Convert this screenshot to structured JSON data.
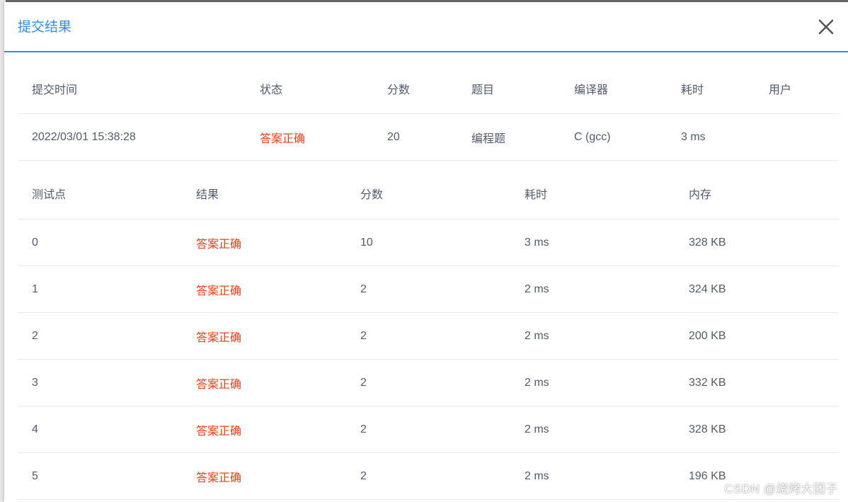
{
  "modal": {
    "title": "提交结果"
  },
  "colors": {
    "accent": "#2d8cf0",
    "status_ok": "#ed3f14",
    "text": "#515a6e",
    "divider": "#e8eaec"
  },
  "icons": {
    "close": "close-icon"
  },
  "summary": {
    "headers": [
      "提交时间",
      "状态",
      "分数",
      "题目",
      "编译器",
      "耗时",
      "用户"
    ],
    "row": {
      "time": "2022/03/01 15:38:28",
      "status": "答案正确",
      "score": "20",
      "problem": "编程题",
      "compiler": "C (gcc)",
      "duration": "3 ms",
      "user": ""
    }
  },
  "cases": {
    "headers": [
      "测试点",
      "结果",
      "分数",
      "耗时",
      "内存"
    ],
    "rows": [
      {
        "id": "0",
        "result": "答案正确",
        "score": "10",
        "time": "3 ms",
        "memory": "328 KB"
      },
      {
        "id": "1",
        "result": "答案正确",
        "score": "2",
        "time": "2 ms",
        "memory": "324 KB"
      },
      {
        "id": "2",
        "result": "答案正确",
        "score": "2",
        "time": "2 ms",
        "memory": "200 KB"
      },
      {
        "id": "3",
        "result": "答案正确",
        "score": "2",
        "time": "2 ms",
        "memory": "332 KB"
      },
      {
        "id": "4",
        "result": "答案正确",
        "score": "2",
        "time": "2 ms",
        "memory": "328 KB"
      },
      {
        "id": "5",
        "result": "答案正确",
        "score": "2",
        "time": "2 ms",
        "memory": "196 KB"
      }
    ]
  },
  "watermark": "CSDN @烧烤大团子"
}
